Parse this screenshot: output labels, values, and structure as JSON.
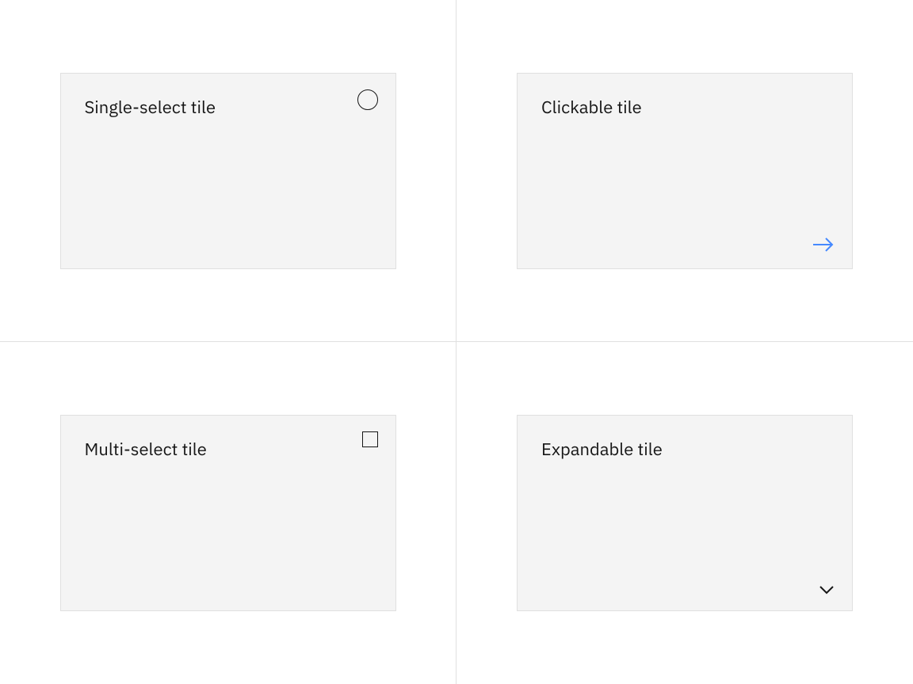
{
  "tiles": {
    "single_select": {
      "label": "Single-select tile"
    },
    "clickable": {
      "label": "Clickable tile"
    },
    "multi_select": {
      "label": "Multi-select tile"
    },
    "expandable": {
      "label": "Expandable tile"
    }
  },
  "colors": {
    "tile_bg": "#f4f4f4",
    "tile_border": "#e0e0e0",
    "text": "#161616",
    "arrow": "#4589ff"
  }
}
